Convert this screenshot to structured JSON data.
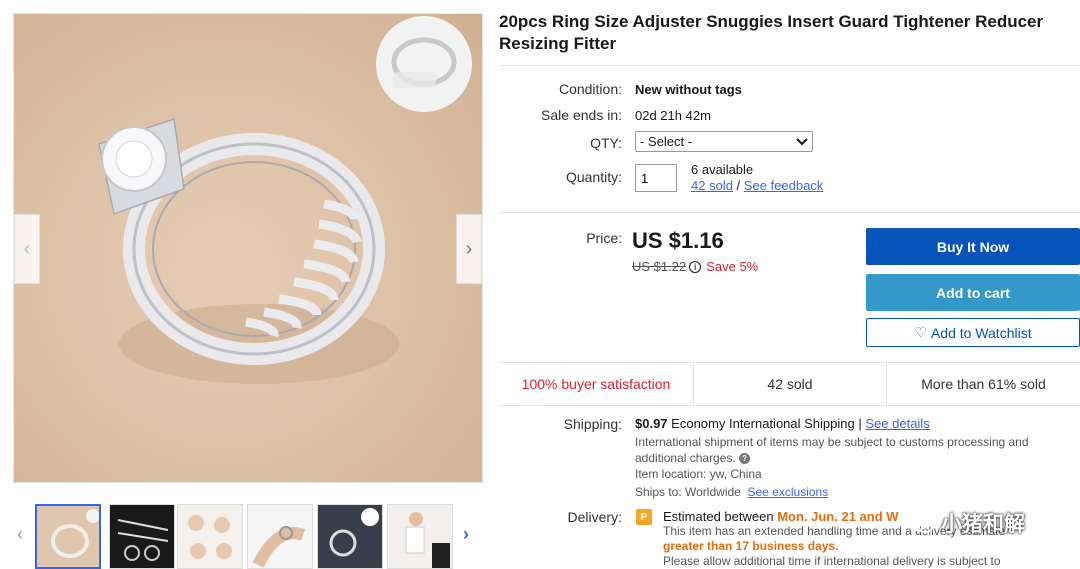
{
  "title": "20pcs Ring Size Adjuster Snuggies Insert Guard Tightener Reducer Resizing Fitter",
  "condition": {
    "label": "Condition:",
    "value": "New without tags"
  },
  "sale_ends": {
    "label": "Sale ends in:",
    "value": "02d 21h 42m"
  },
  "qty_select": {
    "label": "QTY:",
    "value": "- Select -"
  },
  "quantity": {
    "label": "Quantity:",
    "value": "1",
    "available": "6 available",
    "sold_link": "42 sold",
    "separator": "/",
    "feedback_link": "See feedback"
  },
  "price": {
    "label": "Price:",
    "current": "US $1.16",
    "was": "US $1.22",
    "save": "Save 5%"
  },
  "buttons": {
    "buy_now": "Buy It Now",
    "add_to_cart": "Add to cart",
    "watchlist": "Add to Watchlist"
  },
  "stats": {
    "satisfaction": "100% buyer satisfaction",
    "sold": "42 sold",
    "more_sold": "More than 61% sold"
  },
  "shipping": {
    "label": "Shipping:",
    "cost": "$0.97",
    "method": "Economy International Shipping",
    "sep": "|",
    "details_link": "See details",
    "customs_note": "International shipment of items may be subject to customs processing and additional charges.",
    "location": "Item location: yw, China",
    "ships_to": "Ships to: Worldwide",
    "exclusions_link": "See exclusions"
  },
  "delivery": {
    "label": "Delivery:",
    "badge": "P",
    "estimated_prefix": "Estimated between",
    "estimated_dates": "Mon. Jun. 21 and W",
    "handling_note": "This item has an extended handling time and a delivery estimate",
    "handling_highlight": "greater than 17 business days.",
    "allow_note": "Please allow additional time if international delivery is subject to"
  },
  "watermark": "小猪和解",
  "colors": {
    "link": "#3665f3",
    "buy_now": "#0654ba",
    "add_to_cart": "#3498ca",
    "save_red": "#dd1e31",
    "highlight_orange": "#e46d0d"
  }
}
